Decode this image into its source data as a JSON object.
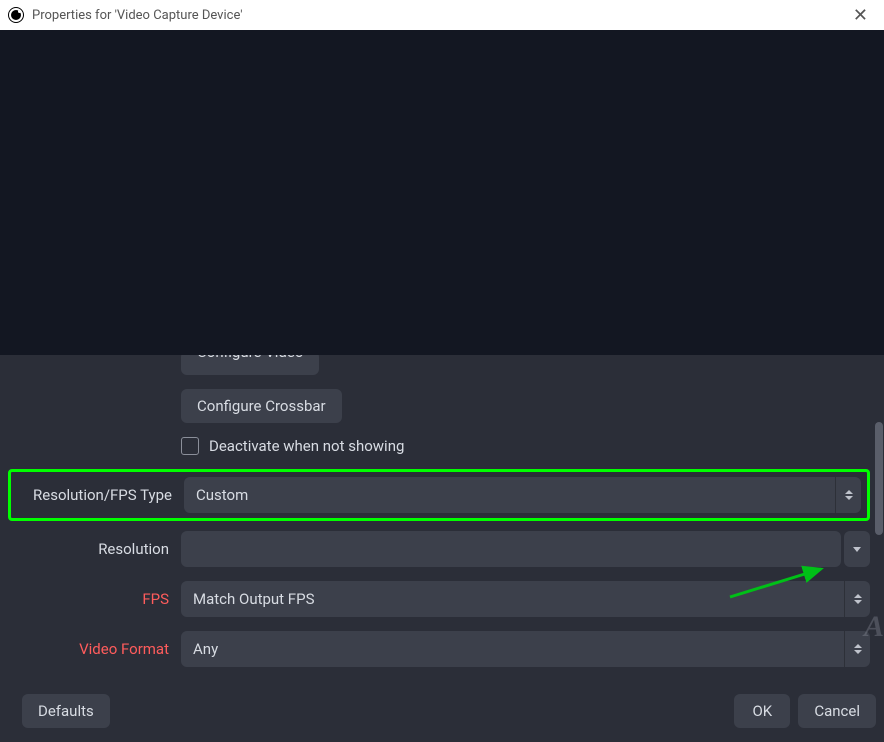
{
  "window": {
    "title": "Properties for 'Video Capture Device'"
  },
  "buttons": {
    "configure_video": "Configure Video",
    "configure_crossbar": "Configure Crossbar",
    "defaults": "Defaults",
    "ok": "OK",
    "cancel": "Cancel"
  },
  "checkbox": {
    "deactivate": "Deactivate when not showing"
  },
  "fields": {
    "res_fps_type": {
      "label": "Resolution/FPS Type",
      "value": "Custom"
    },
    "resolution": {
      "label": "Resolution",
      "value": ""
    },
    "fps": {
      "label": "FPS",
      "value": "Match Output FPS"
    },
    "video_format": {
      "label": "Video Format",
      "value": "Any"
    }
  },
  "annotation": {
    "highlight_color": "#00ff00",
    "arrow_color": "#00c017"
  }
}
